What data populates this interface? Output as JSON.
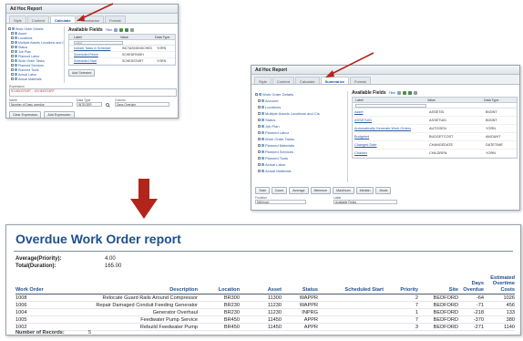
{
  "win1": {
    "title": "Ad Hoc Report",
    "tabs": [
      "Style",
      "Content",
      "Calculate",
      "Summarize",
      "Format"
    ],
    "active_tab": "Calculate",
    "tree": [
      {
        "label": "Work Order Details",
        "level": 1
      },
      {
        "label": "Asset",
        "level": 2
      },
      {
        "label": "Locations",
        "level": 2
      },
      {
        "label": "Multiple Assets Locations and CIs",
        "level": 2
      },
      {
        "label": "Status",
        "level": 2
      },
      {
        "label": "Job Plan",
        "level": 2
      },
      {
        "label": "Planned Labor",
        "level": 2
      },
      {
        "label": "Work Order Tasks",
        "level": 2
      },
      {
        "label": "Planned Services",
        "level": 2
      },
      {
        "label": "Planned Tools",
        "level": 2
      },
      {
        "label": "Actual Labor",
        "level": 2
      },
      {
        "label": "Actual Materials",
        "level": 2
      }
    ],
    "fields_title": "Available Fields",
    "filter_label": "Filter",
    "col_label": "Label",
    "col_value": "Value",
    "col_data_type": "Data Type",
    "rows": [
      {
        "label": "Include Tasks in Schedule",
        "value": "INCTASKSINSCHED",
        "type": "YORN"
      },
      {
        "label": "Scheduled Finish",
        "value": "SCHEDFINISH",
        "type": ""
      },
      {
        "label": "Scheduled Start",
        "value": "SCHEDSTART",
        "type": "YORN"
      }
    ],
    "add_button": "Add Selected",
    "expression_label": "Expression",
    "expression_value": "SCHEDSTART - :SCHEDSTART",
    "name_label": "Name",
    "name_value": "Number of Days overdue",
    "data_type_label": "Data Type",
    "data_type_value": "INTEGER",
    "column_label": "Column",
    "column_value": "Days Overdue",
    "clear_button": "Clear Expression",
    "add_expr_button": "Add Expression"
  },
  "win2": {
    "title": "Ad Hoc Report",
    "tabs": [
      "Style",
      "Content",
      "Calculate",
      "Summarize",
      "Format"
    ],
    "active_tab": "Summarize",
    "tree": [
      {
        "label": "Work Order Details",
        "level": 1
      },
      {
        "label": "Account",
        "level": 2
      },
      {
        "label": "Locations",
        "level": 2
      },
      {
        "label": "Multiple Assets Locations and CIs",
        "level": 2
      },
      {
        "label": "Status",
        "level": 2
      },
      {
        "label": "Job Plan",
        "level": 2
      },
      {
        "label": "Planned Labor",
        "level": 2
      },
      {
        "label": "Work Order Tasks",
        "level": 2
      },
      {
        "label": "Planned Materials",
        "level": 2
      },
      {
        "label": "Planned Services",
        "level": 2
      },
      {
        "label": "Planned Tools",
        "level": 2
      },
      {
        "label": "Actual Labor",
        "level": 2
      },
      {
        "label": "Actual Materials",
        "level": 2
      }
    ],
    "fields_title": "Available Fields",
    "filter_label": "Filter",
    "col_label": "Label",
    "col_value": "Value",
    "col_data_type": "Data Type",
    "rows": [
      {
        "label": "Asset",
        "value": "ASSETID",
        "type": "BIGINT"
      },
      {
        "label": "ASSETUID",
        "value": "ASSETUID",
        "type": "BIGINT"
      },
      {
        "label": "Automatically Generate Work Orders",
        "value": "AUTOGEN",
        "type": "YORN"
      },
      {
        "label": "Budgeted",
        "value": "BUDGETCOST",
        "type": "AMOUNT"
      },
      {
        "label": "Changed Date",
        "value": "CHANGEDATE",
        "type": "DATETIME"
      },
      {
        "label": "Children",
        "value": "CHILDREN",
        "type": "YORN"
      }
    ],
    "agg_buttons": [
      "Total",
      "Count",
      "Average",
      "Minimum",
      "Maximum",
      "Median",
      "Mode"
    ],
    "func_label": "Function",
    "func_value": "Minimum",
    "label_label": "Label",
    "label_value": "Available Fields"
  },
  "report": {
    "title": "Overdue Work Order report",
    "summary": [
      {
        "label": "Average(Priority):",
        "value": "4.00"
      },
      {
        "label": "Total(Duration):",
        "value": "165.00"
      }
    ],
    "columns": [
      "Work Order",
      "Description",
      "Location",
      "Asset",
      "Status",
      "Scheduled Start",
      "Priority",
      "Site",
      "Days Overdue",
      "Estimated Overtime Costs"
    ],
    "rows": [
      [
        "1008",
        "Relocate Guard Rails Around Compressor",
        "BR300",
        "11300",
        "WAPPR",
        "",
        "2",
        "BEDFORD",
        "-64",
        "1026"
      ],
      [
        "1006",
        "Repair Damaged Conduit Feeding Generator",
        "BR230",
        "11230",
        "WAPPR",
        "",
        "7",
        "BEDFORD",
        "-71",
        "456"
      ],
      [
        "1004",
        "Generator Overhaul",
        "BR230",
        "11230",
        "INPRG",
        "",
        "1",
        "BEDFORD",
        "-218",
        "133"
      ],
      [
        "1005",
        "Feedwater Pump Service",
        "BR450",
        "11450",
        "APPR",
        "",
        "7",
        "BEDFORD",
        "-370",
        "380"
      ],
      [
        "1002",
        "Rebuild Feedwater Pump",
        "BR450",
        "11450",
        "APPR",
        "",
        "3",
        "BEDFORD",
        "-271",
        "1140"
      ]
    ],
    "num_records_label": "Number of Records:",
    "num_records_value": "5"
  },
  "colors": {
    "accent": "#1d4f8f",
    "arrow": "#b3241b",
    "link": "#2c5aa0"
  }
}
